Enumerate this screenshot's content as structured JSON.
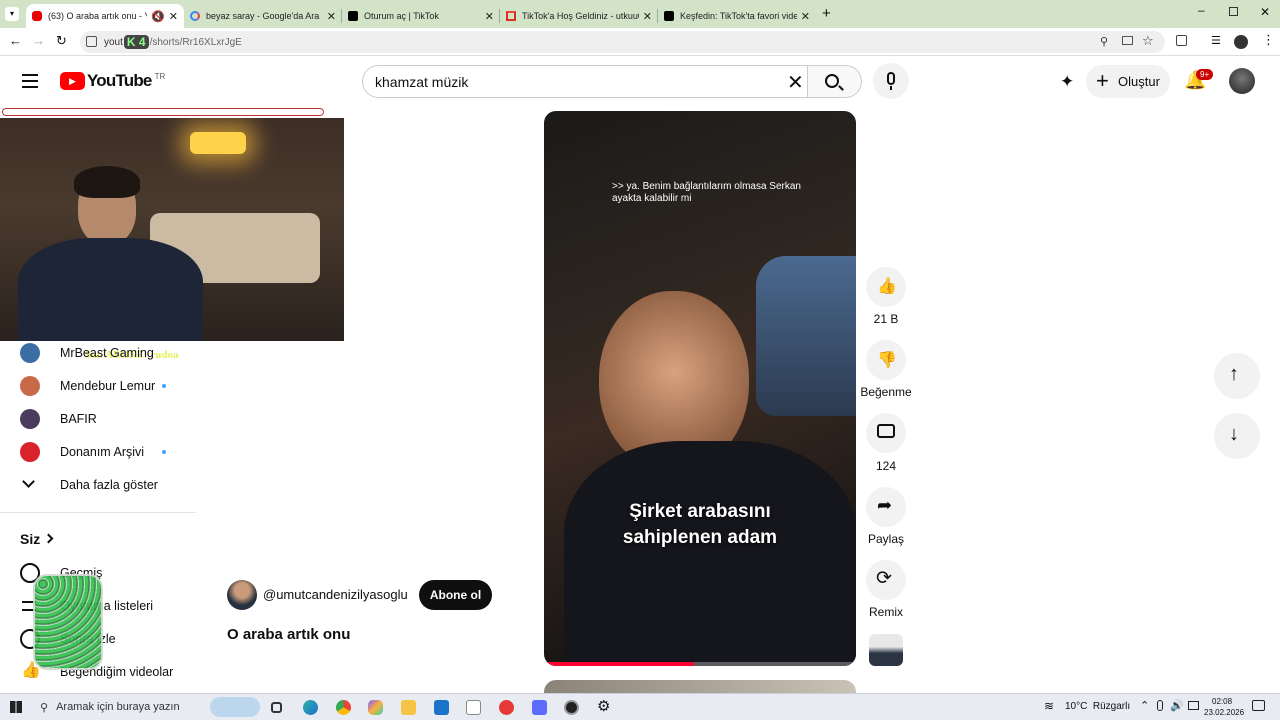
{
  "browser": {
    "tabs": [
      {
        "title": "(63) O araba artık onu - You",
        "active": true
      },
      {
        "title": "beyaz saray - Google'da Ara"
      },
      {
        "title": "Oturum aç | TikTok"
      },
      {
        "title": "TikTok'a Hoş Geldiniz - utkuu0"
      },
      {
        "title": "Keşfedin: TikTok'ta favori video"
      }
    ],
    "url_prefix": "yout",
    "url_rest": "/shorts/Rr16XLxrJgE",
    "overlay_badge": "K 4"
  },
  "youtube": {
    "logo": "YouTube",
    "country": "TR",
    "search_value": "khamzat müzik",
    "create_label": "Oluştur",
    "notif_count": "9+"
  },
  "sidebar": {
    "subscriptions": [
      {
        "label": "MrBeast Gaming",
        "dot": false
      },
      {
        "label": "Mendebur Lemur",
        "dot": true
      },
      {
        "label": "BAFIR",
        "dot": false
      },
      {
        "label": "Donanım Arşivi",
        "dot": true
      }
    ],
    "more_label": "Daha fazla göster",
    "you_heading": "Siz",
    "you_items": [
      "Geçmiş",
      "Oynatma listeleri",
      "Sonra izle",
      "Beğendiğim videolar"
    ]
  },
  "stream_overlay": {
    "caption": "Son ABONE: rudoa"
  },
  "short": {
    "subtitle": ">> ya. Benim bağlantılarım olmasa Serkan ayakta kalabilir mi",
    "caption_line1": "Şirket arabasını",
    "caption_line2": "sahiplenen adam",
    "channel": "@umutcandenizilyasoglu",
    "subscribe_label": "Abone ol",
    "title": "O araba artık onu",
    "likes": "21 B",
    "dislike_label": "Beğenme",
    "comments": "124",
    "share_label": "Paylaş",
    "remix_label": "Remix"
  },
  "taskbar": {
    "search_placeholder": "Aramak için buraya yazın",
    "weather": "10°C  Rüzgarlı",
    "time": "02:08",
    "date": "23.02.2026"
  }
}
